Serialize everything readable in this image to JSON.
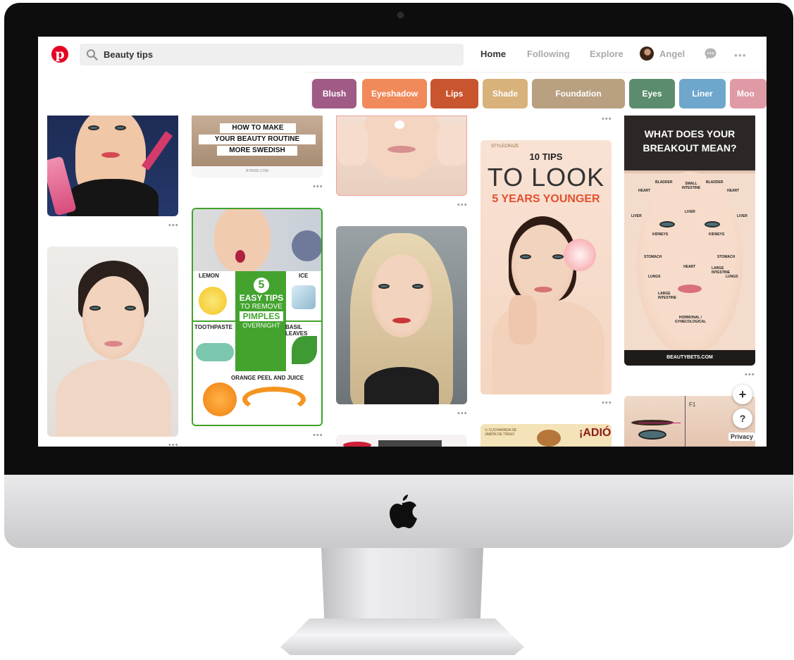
{
  "header": {
    "search_value": "Beauty tips",
    "nav": {
      "home": "Home",
      "following": "Following",
      "explore": "Explore"
    },
    "user_name": "Angel",
    "more_label": "•••"
  },
  "chips": [
    {
      "label": "Blush",
      "color": "#a05a86"
    },
    {
      "label": "Eyeshadow",
      "color": "#f08a5a"
    },
    {
      "label": "Lips",
      "color": "#c8552e"
    },
    {
      "label": "Shade",
      "color": "#d8b27a"
    },
    {
      "label": "Foundation",
      "color": "#b8a080"
    },
    {
      "label": "Eyes",
      "color": "#5b8c6e"
    },
    {
      "label": "Liner",
      "color": "#6ea6cc"
    },
    {
      "label": "Moo",
      "color": "#e09aa6"
    }
  ],
  "pins": {
    "more": "•••",
    "routine": {
      "lines": [
        "HOW TO MAKE",
        "YOUR BEAUTY ROUTINE",
        "MORE SWEDISH"
      ],
      "source": "BYRDIE.COM"
    },
    "pimples": {
      "number": "5",
      "title": "EASY TIPS",
      "sub": "TO REMOVE",
      "key": "PIMPLES",
      "tail": "OVERNIGHT",
      "labels": {
        "lemon": "LEMON",
        "ice": "ICE",
        "toothpaste": "TOOTHPASTE",
        "basil": "BASIL LEAVES",
        "orange": "ORANGE PEEL AND JUICE"
      }
    },
    "look": {
      "tag": "STYLECRAZE",
      "line1": "10 TIPS",
      "line2": "TO LOOK",
      "line3": "5 YEARS YOUNGER"
    },
    "breakout": {
      "title_1": "WHAT DOES YOUR",
      "title_2": "BREAKOUT MEAN?",
      "footer": "BEAUTYBETS.COM",
      "zones": [
        "BLADDER",
        "SMALL INTESTINE",
        "BLADDER",
        "HEART",
        "HEART",
        "LIVER",
        "LIVER",
        "LIVER",
        "KIDNEYS",
        "KIDNEYS",
        "STOMACH",
        "STOMACH",
        "HEART",
        "LUNGS",
        "LUNGS",
        "LARGE INTESTINE",
        "LARGE INTESTINE",
        "HORMONAL / GYNECOLOGICAL"
      ]
    },
    "adios": {
      "text": "¡ADIÓS",
      "small": "½ CUCHARADA DE JABÓN DE TRIGO"
    },
    "eyebrow": {
      "label": "F1"
    }
  },
  "floating": {
    "plus": "+",
    "help": "?",
    "privacy": "Privacy"
  }
}
